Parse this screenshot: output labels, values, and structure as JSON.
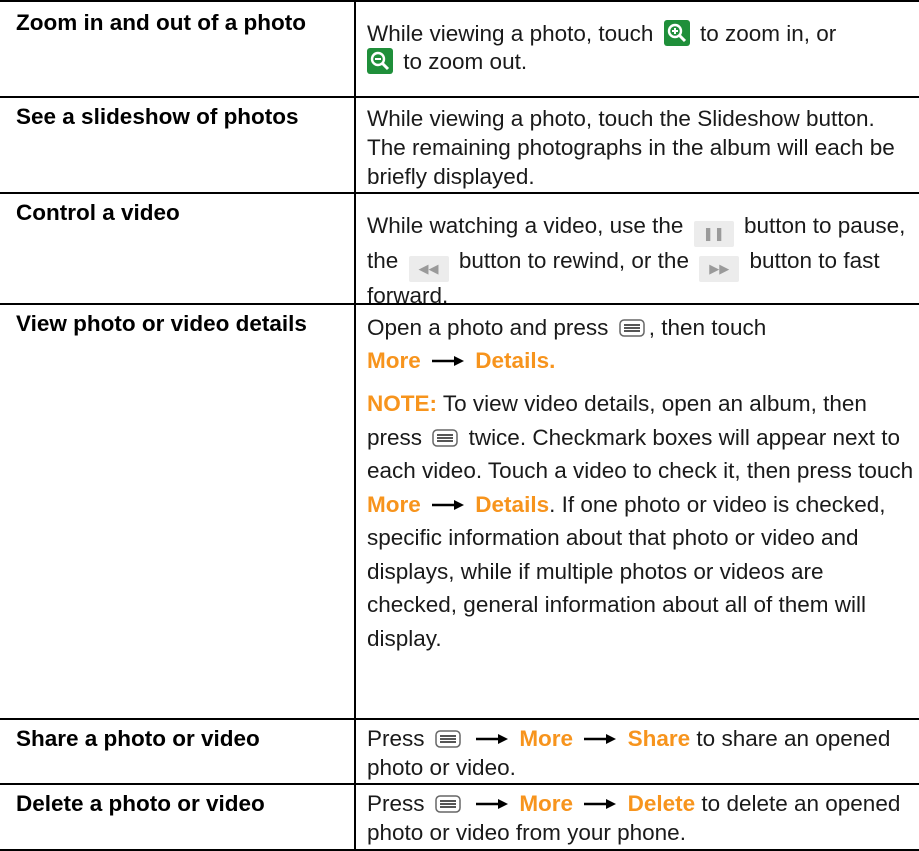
{
  "rows": [
    {
      "title": "Zoom in and out of a photo",
      "desc": {
        "p1": "While viewing a photo, touch",
        "p2": "to zoom in, or",
        "p3": "to zoom out."
      }
    },
    {
      "title": "See a slideshow of photos",
      "desc": {
        "text": "While viewing a photo, touch the Slideshow button. The remaining photographs in the album will each be briefly displayed."
      }
    },
    {
      "title": "Control a video",
      "desc": {
        "p1": "While watching a video, use the",
        "p2": "button to pause, the",
        "p3": "button to rewind, or the",
        "p4": "button to fast forward."
      }
    },
    {
      "title": "View photo or video details",
      "desc": {
        "p1": "Open a photo and press",
        "p2": ", then touch",
        "more": "More",
        "details": "Details.",
        "note_label": "NOTE:",
        "note_p1": "To view video details, open an album, then press",
        "note_p2": "twice. Checkmark boxes will appear next to each video. Touch a video to check it, then press touch",
        "note_more": "More",
        "note_details": "Details",
        "note_p3": ". If one photo or video is checked, specific information about that photo or video and displays, while if multiple photos or videos are checked, general information about all of them will display."
      }
    },
    {
      "title": "Share a photo or video",
      "desc": {
        "p1": "Press",
        "more": "More",
        "action": "Share",
        "p2": "to share an opened photo or video."
      }
    },
    {
      "title": "Delete a photo or video",
      "desc": {
        "p1": "Press",
        "more": "More",
        "action": "Delete",
        "p2": "to delete an opened photo or video from your phone."
      }
    }
  ],
  "icons": {
    "zoom_in": "zoom-in-icon",
    "zoom_out": "zoom-out-icon",
    "pause": "pause-icon",
    "rewind": "rewind-icon",
    "fast_forward": "fast-forward-icon",
    "menu": "menu-key-icon",
    "arrow": "right-arrow-icon"
  },
  "colors": {
    "highlight": "#f7941d",
    "zoom_icon_bg": "#1f8f3a",
    "rule": "#000000"
  }
}
